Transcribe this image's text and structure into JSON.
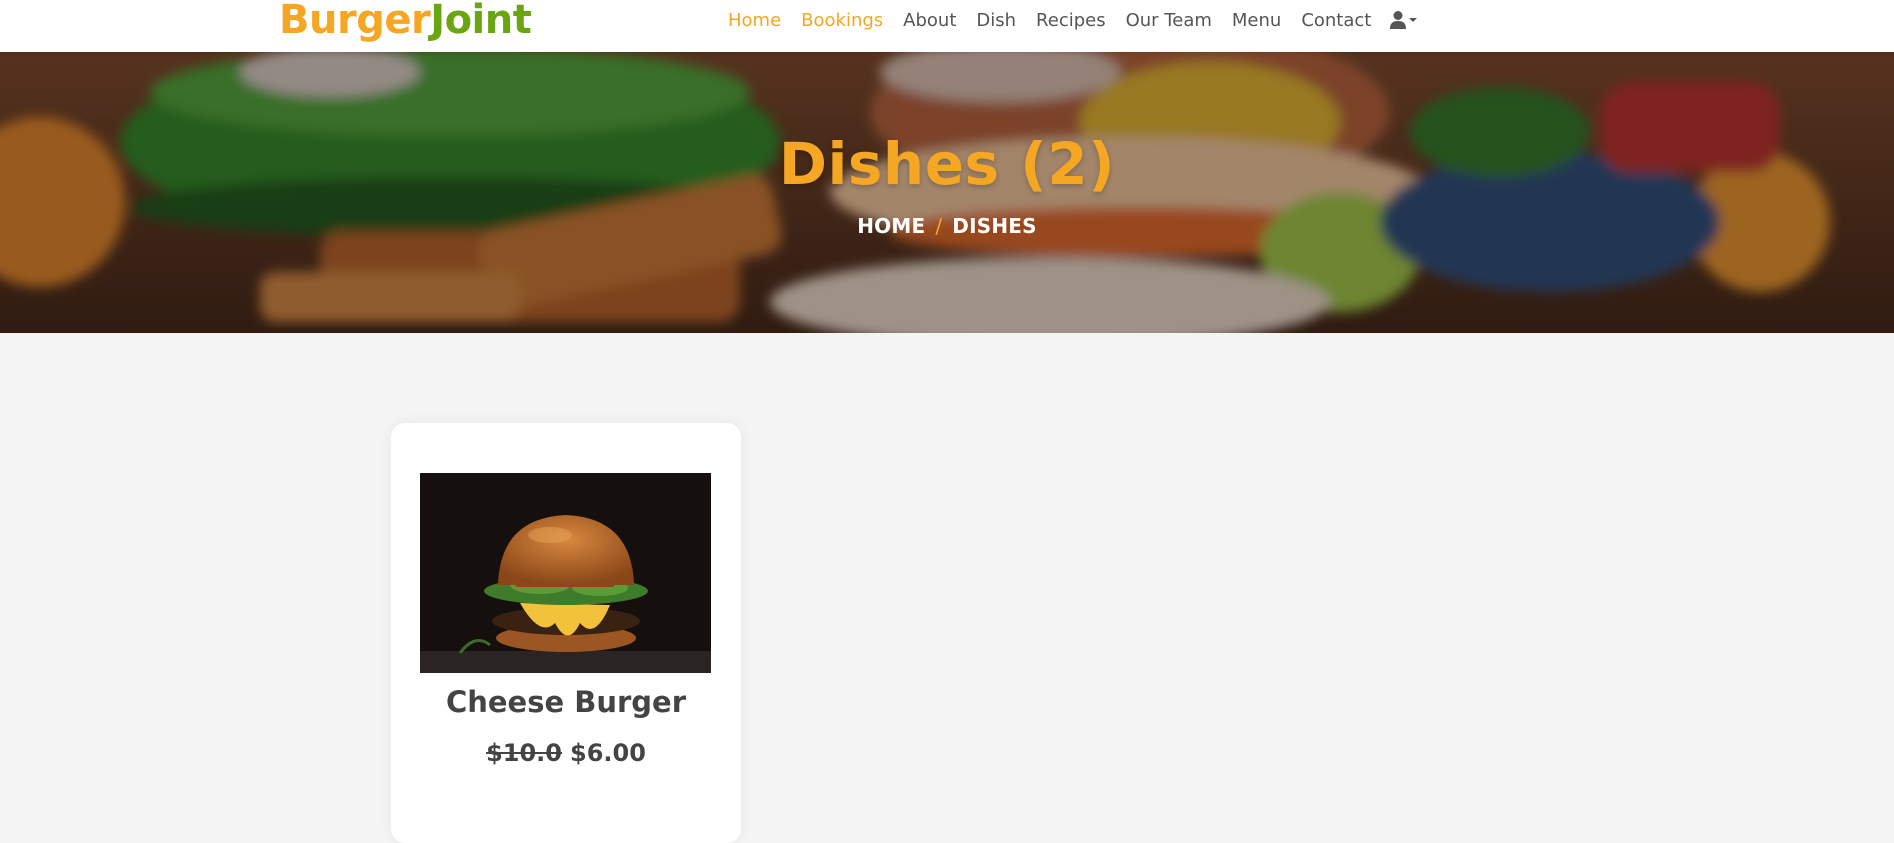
{
  "brand": {
    "part1": "Burger",
    "part2": "Joint"
  },
  "nav": {
    "items": [
      {
        "label": "Home",
        "active": true
      },
      {
        "label": "Bookings",
        "active": true
      },
      {
        "label": "About",
        "active": false
      },
      {
        "label": "Dish",
        "active": false
      },
      {
        "label": "Recipes",
        "active": false
      },
      {
        "label": "Our Team",
        "active": false
      },
      {
        "label": "Menu",
        "active": false
      },
      {
        "label": "Contact",
        "active": false
      }
    ],
    "user_icon": "user-icon"
  },
  "hero": {
    "title": "Dishes (2)",
    "breadcrumb": {
      "home": "HOME",
      "separator": "/",
      "current": "DISHES"
    }
  },
  "dishes": [
    {
      "name": "Cheese Burger",
      "old_price": "$10.0",
      "price": "$6.00"
    }
  ],
  "colors": {
    "accent": "#f5a623",
    "brand_green": "#6aa512",
    "text": "#555555",
    "background": "#f4f4f4"
  }
}
